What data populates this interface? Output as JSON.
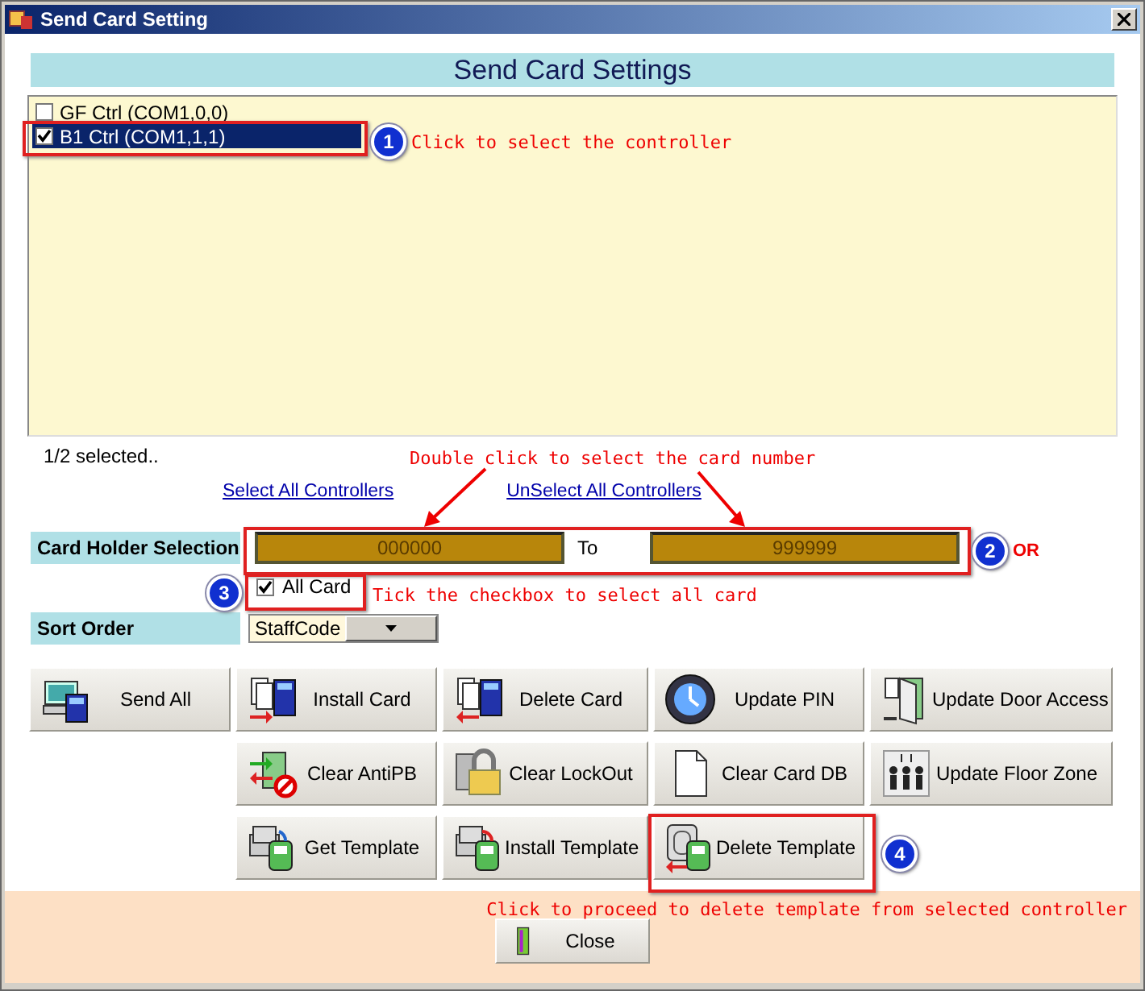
{
  "window": {
    "title": "Send Card Setting"
  },
  "header": "Send Card Settings",
  "controllers": [
    {
      "label": "GF Ctrl (COM1,0,0)",
      "checked": false,
      "selected": false
    },
    {
      "label": "B1 Ctrl (COM1,1,1)",
      "checked": true,
      "selected": true
    }
  ],
  "selection_count": "1/2 selected..",
  "links": [
    "Select All Controllers",
    "UnSelect All Controllers"
  ],
  "card_holder": {
    "label": "Card Holder Selection",
    "from": "000000",
    "to_label": "To",
    "to": "999999"
  },
  "all_card": {
    "label": "All Card",
    "checked": true
  },
  "sort_order": {
    "label": "Sort Order",
    "value": "StaffCode"
  },
  "button_rows": [
    [
      "Send All",
      "Install Card",
      "Delete Card",
      "Update PIN",
      "Update Door Access"
    ],
    [
      "Clear AntiPB",
      "Clear LockOut",
      "Clear Card DB",
      "Update Floor Zone"
    ],
    [
      "Get Template",
      "Install Template",
      "Delete Template"
    ]
  ],
  "close_button": "Close",
  "annotations": [
    {
      "number": "1",
      "text": "Click to select the controller"
    },
    {
      "number": "2",
      "text": "OR"
    },
    {
      "number": "3",
      "text": "Tick the checkbox to select all card"
    },
    {
      "number": "4",
      "text": "Click to proceed to delete template from selected controller"
    }
  ],
  "card_number_hint": "Double click to select the card number"
}
